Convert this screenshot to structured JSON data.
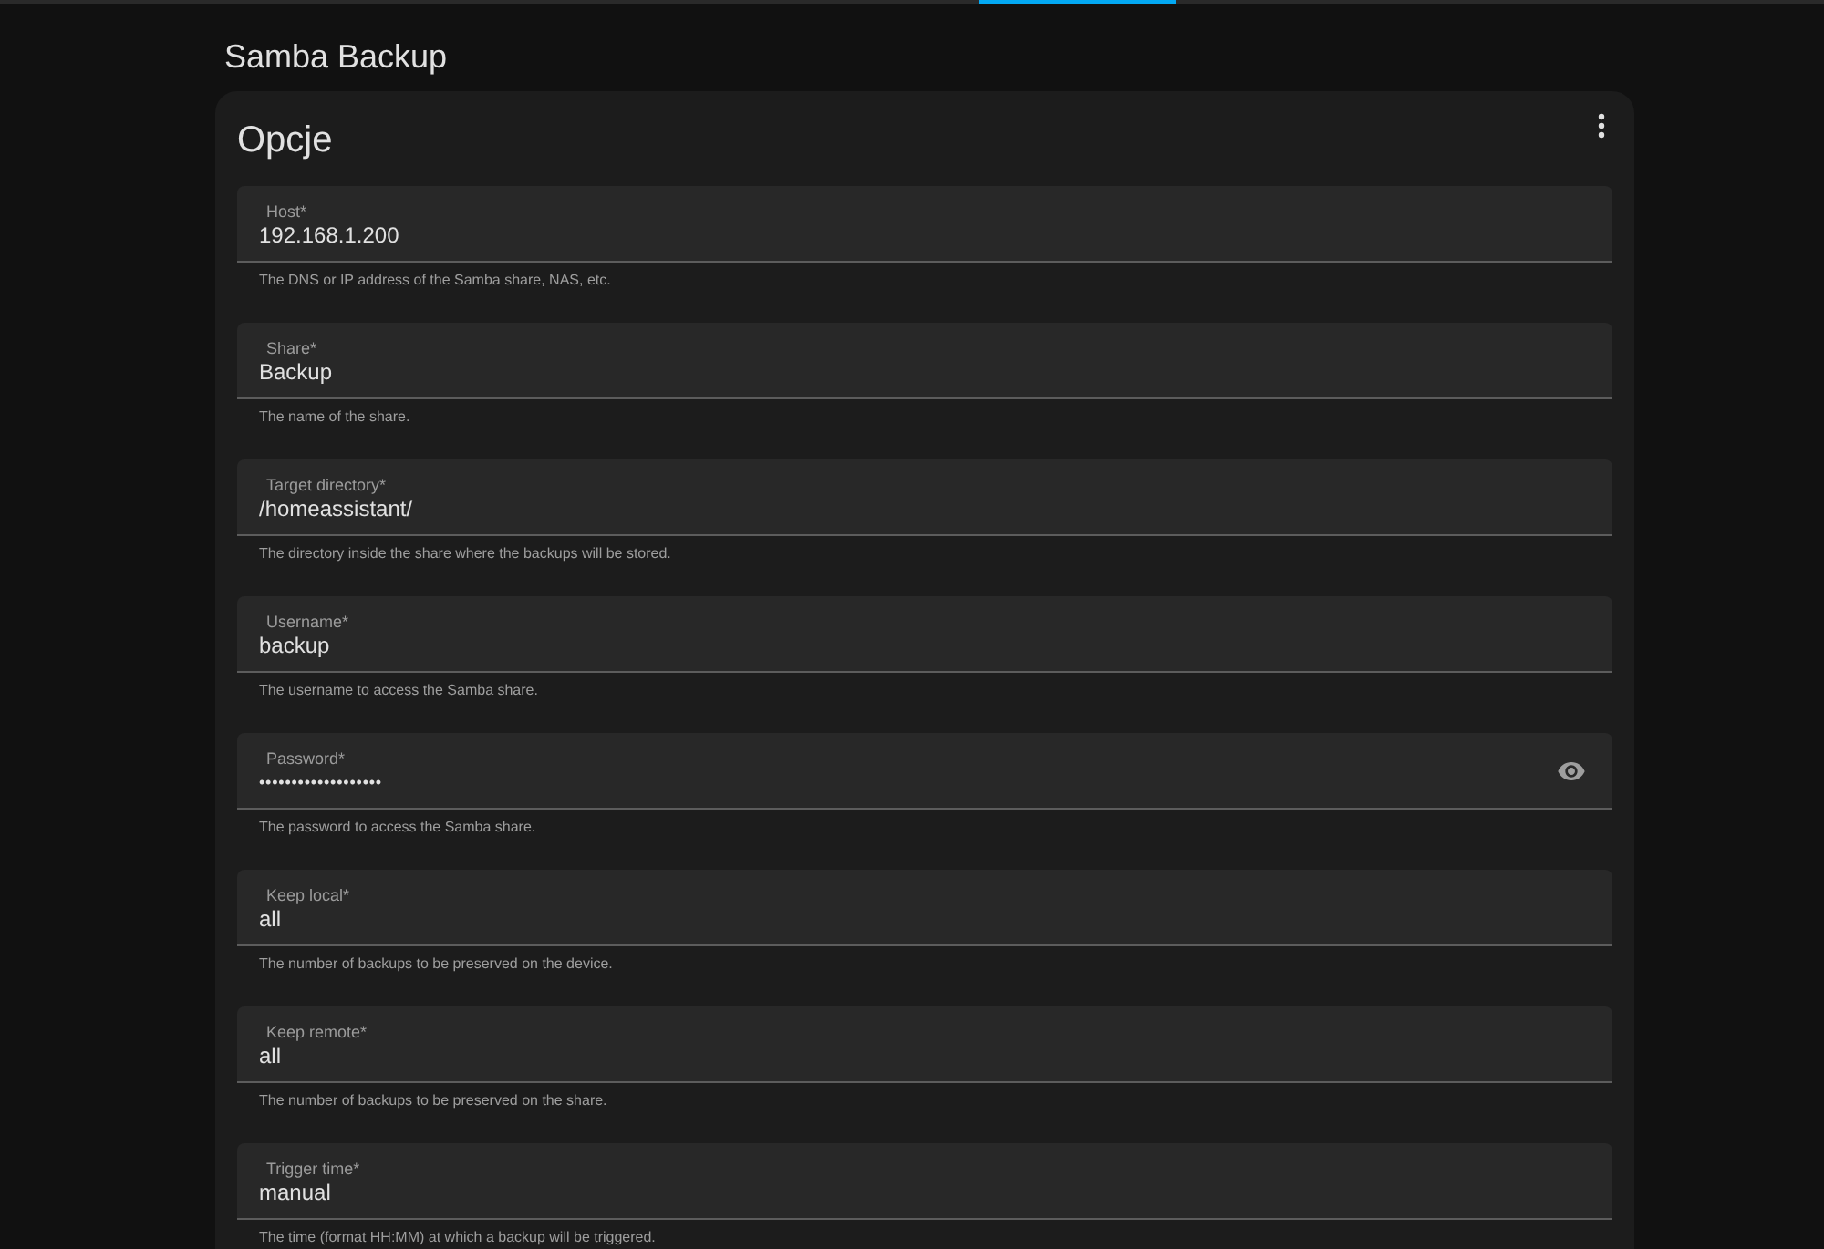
{
  "header": {
    "title": "Samba Backup"
  },
  "card": {
    "title": "Opcje",
    "fields": [
      {
        "kind": "text",
        "label": "Host*",
        "value": "192.168.1.200",
        "helper": "The DNS or IP address of the Samba share, NAS, etc."
      },
      {
        "kind": "text",
        "label": "Share*",
        "value": "Backup",
        "helper": "The name of the share."
      },
      {
        "kind": "text",
        "label": "Target directory*",
        "value": "/homeassistant/",
        "helper": "The directory inside the share where the backups will be stored."
      },
      {
        "kind": "text",
        "label": "Username*",
        "value": "backup",
        "helper": "The username to access the Samba share."
      },
      {
        "kind": "password",
        "label": "Password*",
        "value": "•••••••••••••••••••",
        "helper": "The password to access the Samba share."
      },
      {
        "kind": "text",
        "label": "Keep local*",
        "value": "all",
        "helper": "The number of backups to be preserved on the device."
      },
      {
        "kind": "text",
        "label": "Keep remote*",
        "value": "all",
        "helper": "The number of backups to be preserved on the share."
      },
      {
        "kind": "text",
        "label": "Trigger time*",
        "value": "manual",
        "helper": "The time (format HH:MM) at which a backup will be triggered."
      }
    ]
  }
}
